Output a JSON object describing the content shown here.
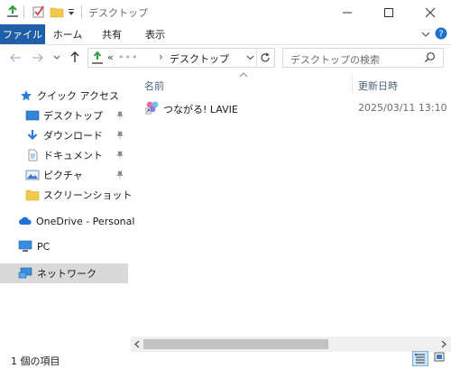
{
  "window": {
    "title": "デスクトップ"
  },
  "ribbon": {
    "tabs": [
      {
        "label": "ファイル"
      },
      {
        "label": "ホーム"
      },
      {
        "label": "共有"
      },
      {
        "label": "表示"
      }
    ]
  },
  "address": {
    "prefix": "«",
    "hidden_segment": "•••",
    "separator": "›",
    "current": "デスクトップ"
  },
  "search": {
    "placeholder": "デスクトップの検索"
  },
  "sidebar": {
    "quick_access": "クイック アクセス",
    "items": [
      {
        "label": "デスクトップ",
        "pinned": true
      },
      {
        "label": "ダウンロード",
        "pinned": true
      },
      {
        "label": "ドキュメント",
        "pinned": true
      },
      {
        "label": "ピクチャ",
        "pinned": true
      },
      {
        "label": "スクリーンショット",
        "pinned": false
      }
    ],
    "onedrive": "OneDrive - Personal",
    "pc": "PC",
    "network": "ネットワーク"
  },
  "columns": {
    "name": "名前",
    "date": "更新日時"
  },
  "files": [
    {
      "name": "つながる! LAVIE",
      "modified": "2025/03/11 13:10"
    }
  ],
  "status": {
    "count_text": "1 個の項目"
  },
  "colors": {
    "accent": "#1f5fa8",
    "folder": "#f3c94a",
    "selected_nav": "#d9d9d9"
  }
}
